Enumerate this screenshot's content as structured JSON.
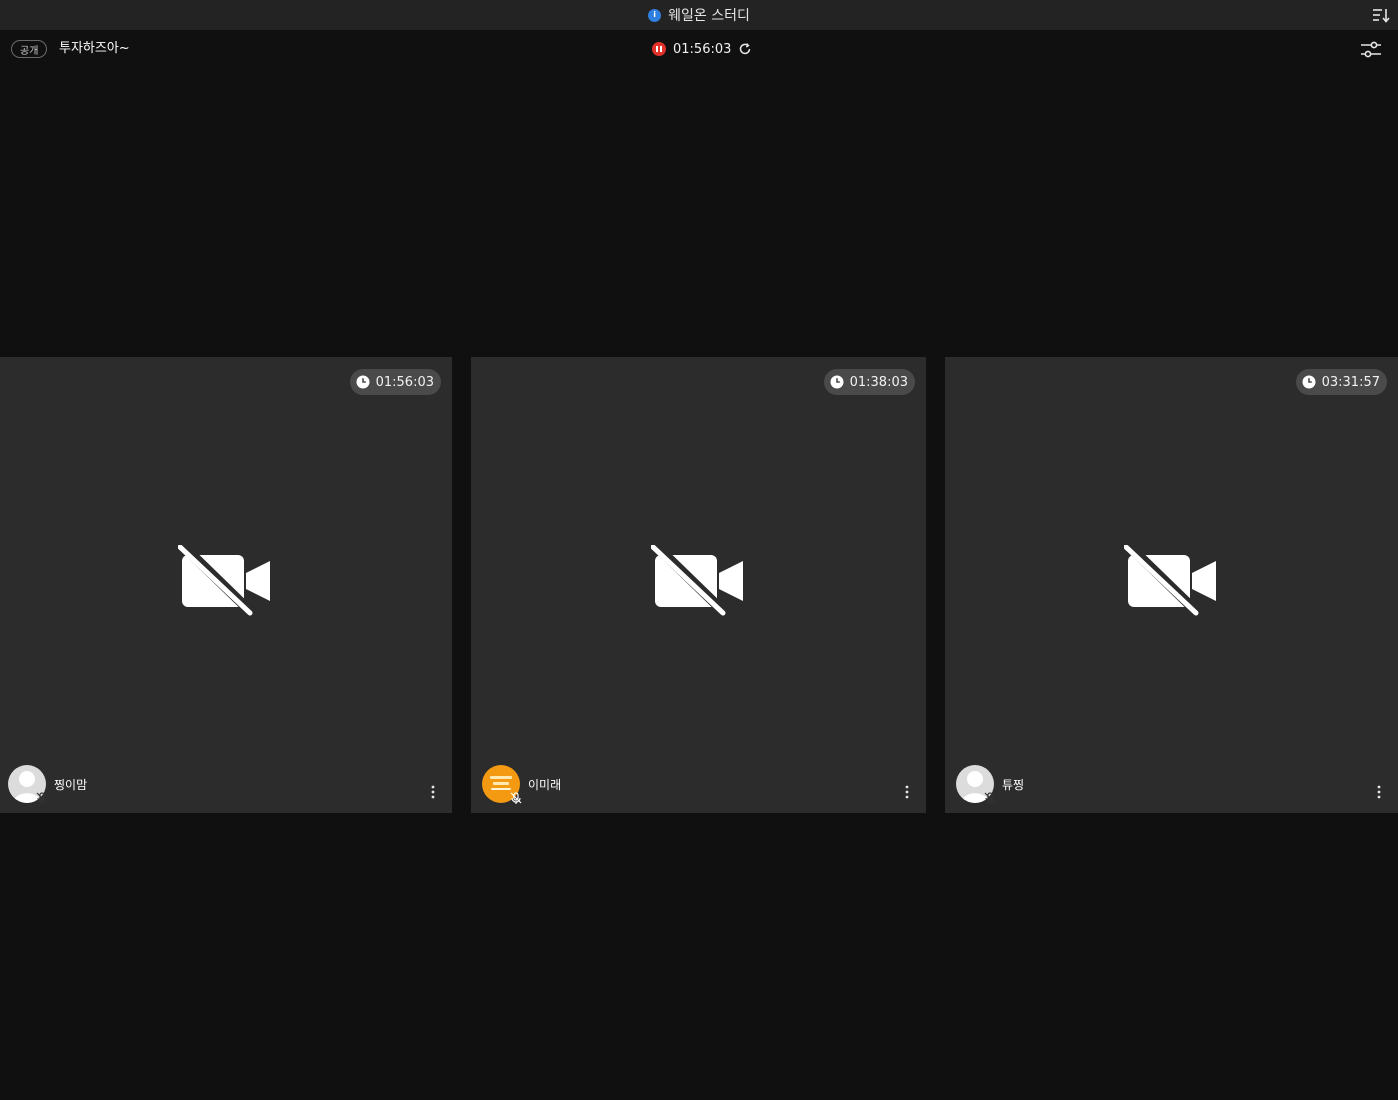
{
  "window": {
    "title": "웨일온 스터디",
    "title_icon": "info-circle-icon",
    "sort_icon": "sort-icon"
  },
  "room": {
    "visibility_badge": "공개",
    "name": "투자하즈아~",
    "elapsed": "01:56:03",
    "status_icon": "pause-recording-icon",
    "refresh_icon": "refresh-icon",
    "settings_icon": "settings-sliders-icon"
  },
  "participants": [
    {
      "name": "찡이맘",
      "timer": "01:56:03",
      "avatar": "default",
      "mic": "muted"
    },
    {
      "name": "이미래",
      "timer": "01:38:03",
      "avatar": "orange",
      "mic": "muted"
    },
    {
      "name": "튜찡",
      "timer": "03:31:57",
      "avatar": "default",
      "mic": "muted"
    }
  ],
  "colors": {
    "background": "#101010",
    "tile": "#2c2c2c",
    "recording_red": "#e0322a",
    "info_blue": "#2f7fe0",
    "avatar_orange": "#f39a12"
  }
}
